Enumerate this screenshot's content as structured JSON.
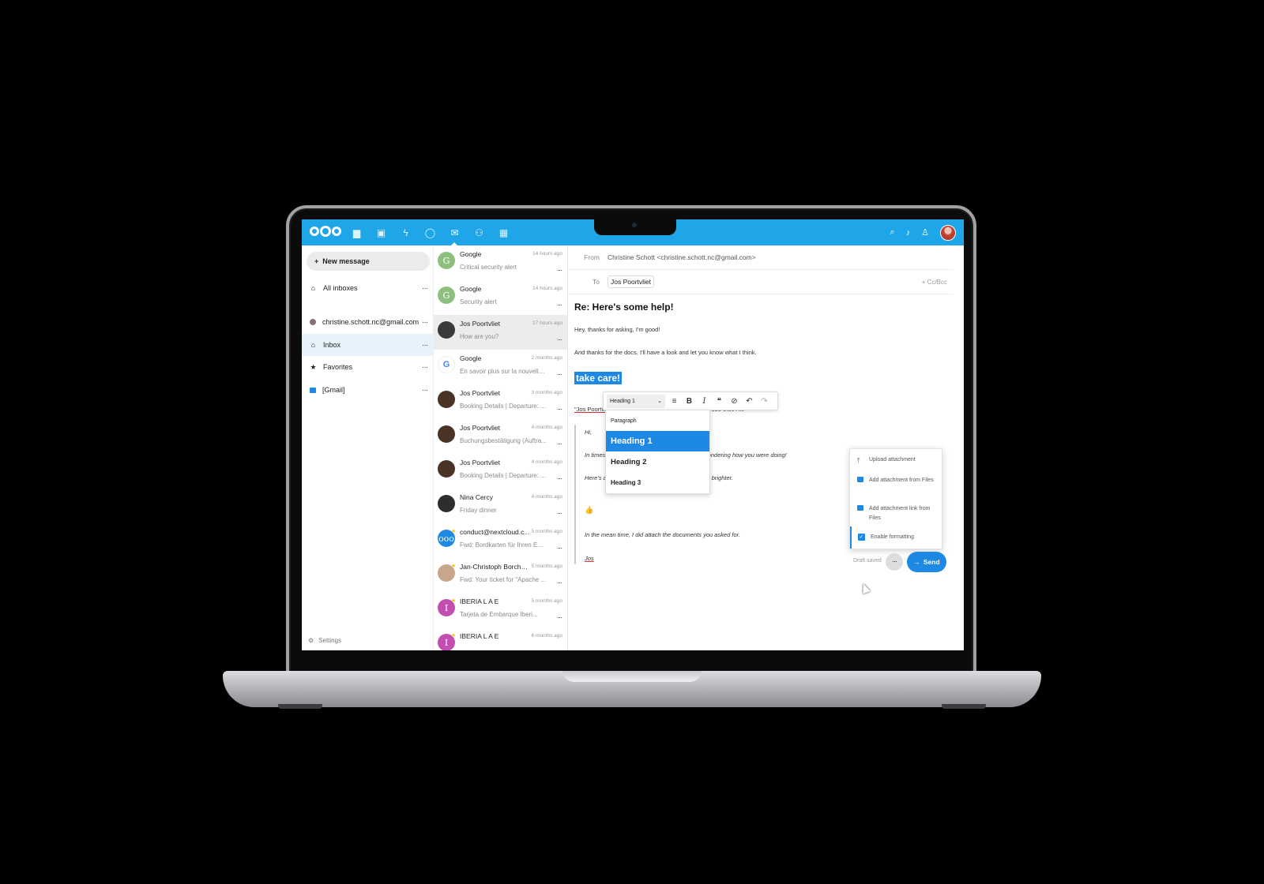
{
  "header": {
    "apps": [
      {
        "icon": "files-icon",
        "glyph": "▆"
      },
      {
        "icon": "photos-icon",
        "glyph": "▣"
      },
      {
        "icon": "activity-icon",
        "glyph": "ϟ"
      },
      {
        "icon": "talk-icon",
        "glyph": "◯"
      },
      {
        "icon": "mail-icon",
        "glyph": "✉"
      },
      {
        "icon": "contacts-icon",
        "glyph": "⚇"
      },
      {
        "icon": "calendar-icon",
        "glyph": "▦"
      }
    ]
  },
  "nav": {
    "new_message": "New message",
    "all_inboxes": "All inboxes",
    "account": "christine.schott.nc@gmail.com",
    "inbox": "Inbox",
    "favorites": "Favorites",
    "gmail": "[Gmail]",
    "settings": "Settings"
  },
  "messages": [
    {
      "from": "Google",
      "time": "14 hours ago",
      "subject": "Critical security alert",
      "avatar": "G",
      "color": "#8fbf7f"
    },
    {
      "from": "Google",
      "time": "14 hours ago",
      "subject": "Security alert",
      "avatar": "G",
      "color": "#8fbf7f"
    },
    {
      "from": "Jos Poortvliet",
      "time": "17 hours ago",
      "subject": "How are you?",
      "avatar": "",
      "color": "#3a3a3a"
    },
    {
      "from": "Google",
      "time": "2 months ago",
      "subject": "En savoir plus sur la nouvelle ...",
      "avatar": "G",
      "color": "#ffffff"
    },
    {
      "from": "Jos Poortvliet",
      "time": "3 months ago",
      "subject": "Booking Details | Departure: ...",
      "avatar": "",
      "color": "#4a3226"
    },
    {
      "from": "Jos Poortvliet",
      "time": "4 months ago",
      "subject": "Buchungsbestätigung (Auftra...",
      "avatar": "",
      "color": "#4a3226"
    },
    {
      "from": "Jos Poortvliet",
      "time": "4 months ago",
      "subject": "Booking Details | Departure: ...",
      "avatar": "",
      "color": "#4a3226"
    },
    {
      "from": "Nina Cercy",
      "time": "4 months ago",
      "subject": "Friday dinner",
      "avatar": "",
      "color": "#2d2d2d"
    },
    {
      "from": "conduct@nextcloud.c...",
      "time": "5 months ago",
      "subject": "Fwd: Bordkarten für Ihren Eur...",
      "avatar": "ooo",
      "color": "#1e88e5"
    },
    {
      "from": "Jan-Christoph Borchardt",
      "time": "5 months ago",
      "subject": "Fwd: Your ticket for \"Apache ...",
      "avatar": "",
      "color": "#c8a68a"
    },
    {
      "from": "IBERIA L A E",
      "time": "5 months ago",
      "subject": "Tarjeta de Embarque Iberi...",
      "avatar": "I",
      "color": "#c24fb0"
    },
    {
      "from": "IBERIA L A E",
      "time": "6 months ago",
      "subject": "",
      "avatar": "I",
      "color": "#c24fb0"
    }
  ],
  "compose": {
    "from_label": "From",
    "from_value": "Christine Schott <christine.schott.nc@gmail.com>",
    "to_label": "To",
    "to_value": "Jos Poortvliet",
    "cc_bcc": "+ Cc/Bcc",
    "subject": "Re: Here's some help!",
    "line1": "Hey, thanks for asking, I'm good!",
    "line2": "And thanks for the docs, I'll have a look and let you know what I think.",
    "selected": "take care!",
    "quote_header_start": "\"Jos Poortvli",
    "quote_header_end": "020 8:56 AM",
    "q_hi": "Hi,",
    "q_line1_start": "In times",
    "q_line1_end": "wondering how you were doing!",
    "q_line2_start": "Here's a",
    "q_line2_end": "brighter.",
    "q_emoji": "👍",
    "q_line3": "In the mean time, I did attach the documents you asked for.",
    "q_sign": "Jos"
  },
  "format_toolbar": {
    "style_select": "Heading 1",
    "options": [
      "Paragraph",
      "Heading 1",
      "Heading 2",
      "Heading 3"
    ]
  },
  "attach_menu": {
    "upload": "Upload attachment",
    "from_files": "Add attachment from Files",
    "link_from_files": "Add attachment link from Files",
    "formatting": "Enable formatting"
  },
  "actions": {
    "draft_status": "Draft saved",
    "send": "Send"
  },
  "colors": {
    "accent": "#1e88e5",
    "header": "#1ea6e8"
  }
}
